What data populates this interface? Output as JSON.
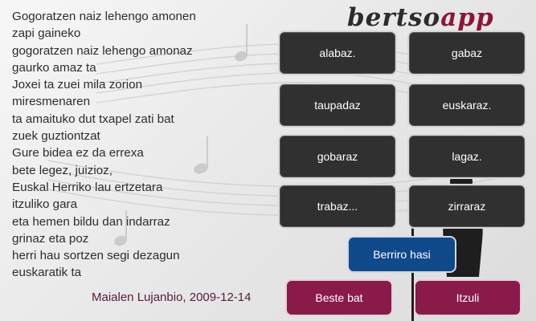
{
  "logo": {
    "part1": "bertso",
    "part2": "app"
  },
  "verse": {
    "lines": [
      "Gogoratzen naiz lehengo amonen",
      "zapi gaineko",
      "gogoratzen naiz lehengo amonaz",
      "gaurko amaz ta",
      "Joxei ta zuei mila zorion",
      "miresmenaren",
      "ta amaituko dut txapel zati bat",
      "zuek guztiontzat",
      "Gure bidea ez da errexa",
      "bete legez, juizioz,",
      "Euskal Herriko lau ertzetara",
      "itzuliko gara",
      "eta hemen bildu dan indarraz",
      "grinaz eta poz",
      "herri hau sortzen segi dezagun",
      "euskaratik ta"
    ],
    "author": "Maialen Lujanbio, 2009-12-14"
  },
  "options": [
    {
      "label": "alabaz."
    },
    {
      "label": "gabaz"
    },
    {
      "label": "taupadaz"
    },
    {
      "label": "euskaraz."
    },
    {
      "label": "gobaraz"
    },
    {
      "label": "lagaz."
    },
    {
      "label": "trabaz..."
    },
    {
      "label": "zirraraz"
    }
  ],
  "actions": {
    "restart": "Berriro hasi",
    "another": "Beste bat",
    "back": "Itzuli"
  },
  "colors": {
    "option_bg": "#303030",
    "restart_bg": "#0f4a8a",
    "action_bg": "#8a1a4a",
    "author_text": "#5a1a3c",
    "logo_accent": "#8b1538"
  }
}
